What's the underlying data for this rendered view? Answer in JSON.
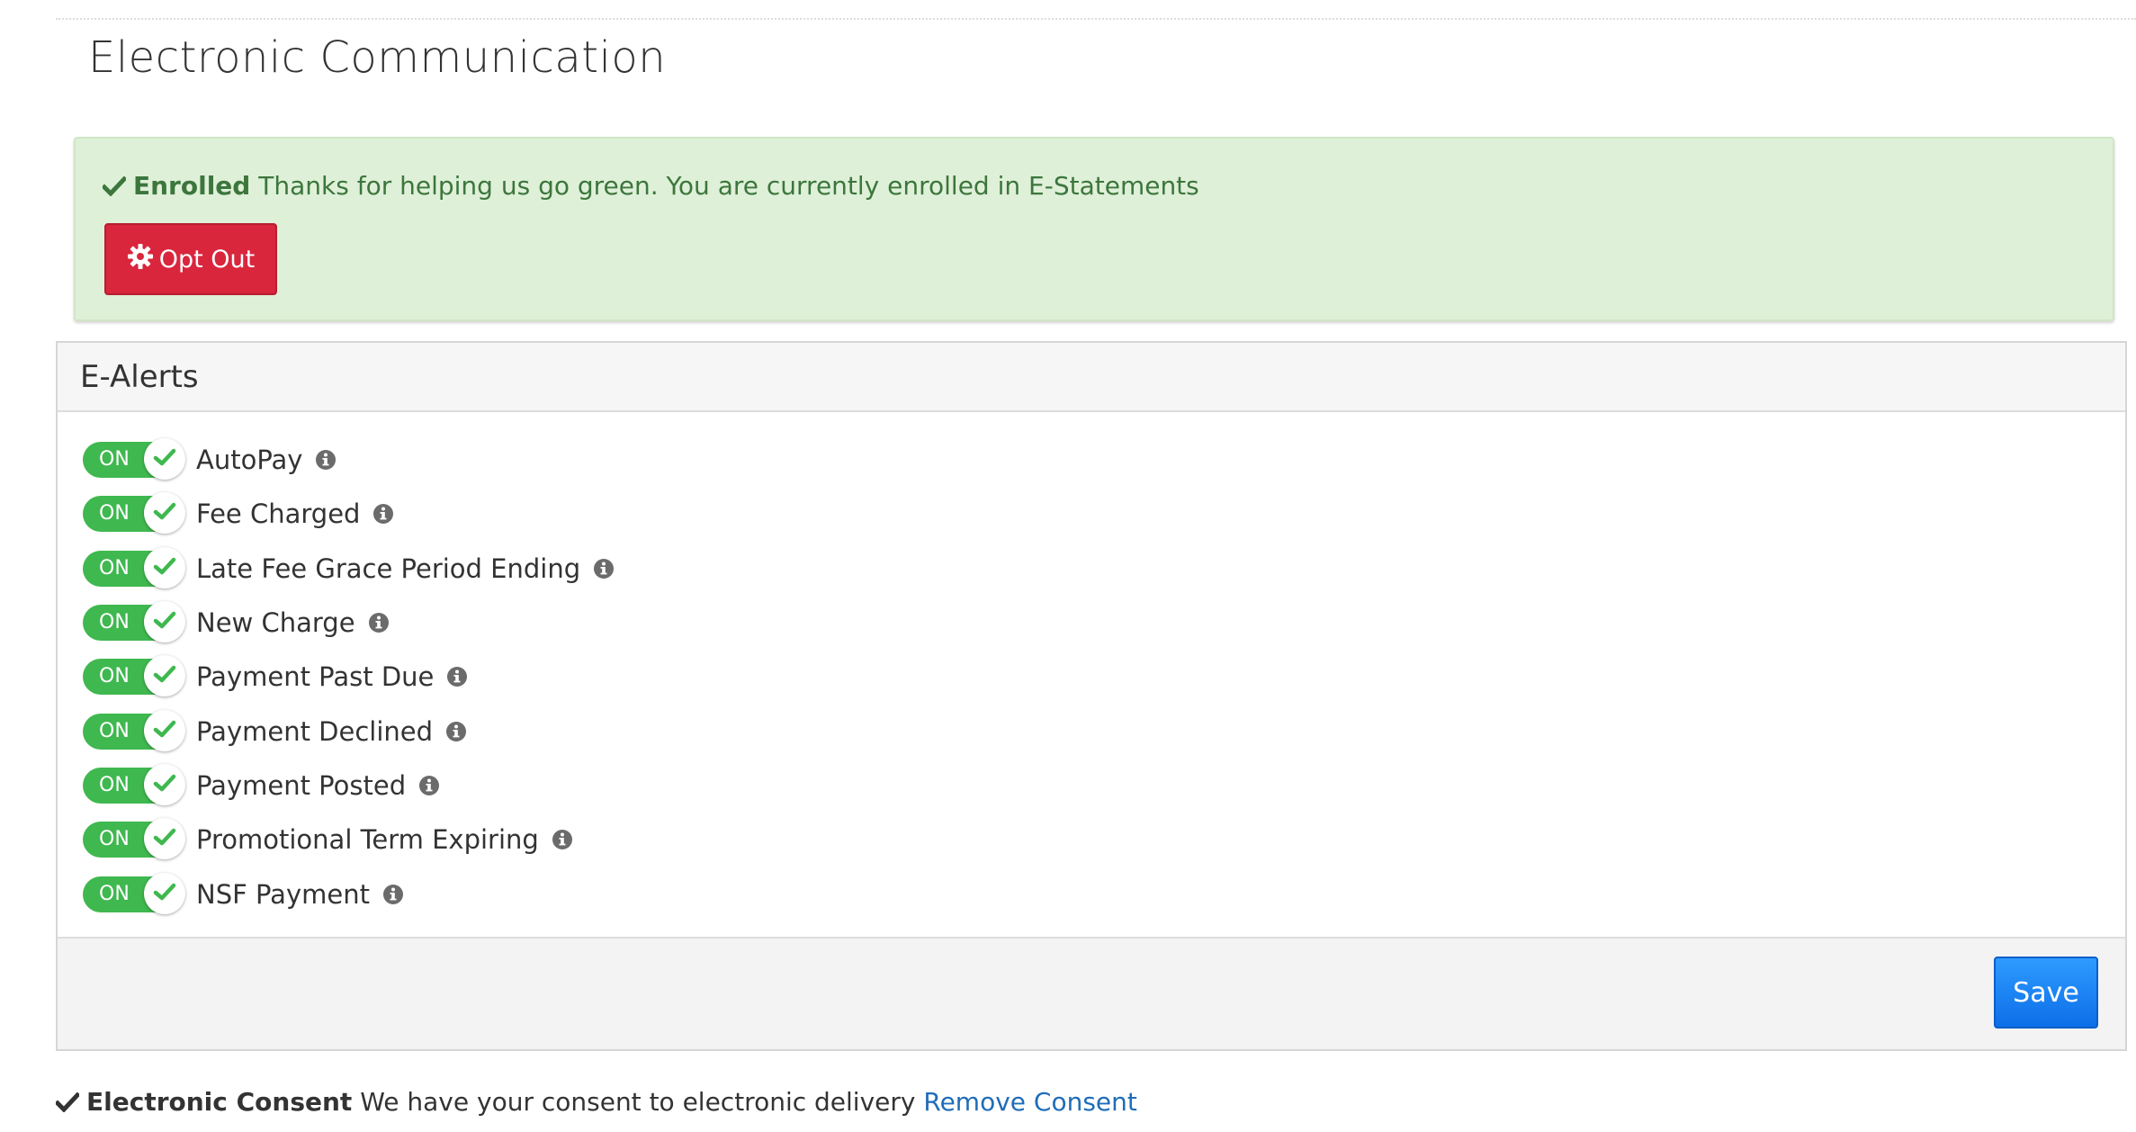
{
  "page": {
    "title": "Electronic Communication"
  },
  "enrollment": {
    "status_label": "Enrolled",
    "message": "Thanks for helping us go green. You are currently enrolled in E-Statements",
    "opt_out_label": "Opt Out",
    "check_icon": "check-icon",
    "gear_icon": "gear-icon",
    "colors": {
      "background": "#dff0d8",
      "text": "#3c763d",
      "opt_out_button": "#d9263d"
    }
  },
  "ealerts": {
    "title": "E-Alerts",
    "toggle_on_text": "ON",
    "toggle_color": "#3fb84f",
    "items": [
      {
        "label": "AutoPay",
        "state": "ON"
      },
      {
        "label": "Fee Charged",
        "state": "ON"
      },
      {
        "label": "Late Fee Grace Period Ending",
        "state": "ON"
      },
      {
        "label": "New Charge",
        "state": "ON"
      },
      {
        "label": "Payment Past Due",
        "state": "ON"
      },
      {
        "label": "Payment Declined",
        "state": "ON"
      },
      {
        "label": "Payment Posted",
        "state": "ON"
      },
      {
        "label": "Promotional Term Expiring",
        "state": "ON"
      },
      {
        "label": "NSF Payment",
        "state": "ON"
      }
    ],
    "save_label": "Save",
    "save_color": "#1a82f7"
  },
  "consent": {
    "title": "Electronic Consent",
    "message": "We have your consent to electronic delivery",
    "remove_label": "Remove Consent",
    "link_color": "#1f6db8"
  }
}
